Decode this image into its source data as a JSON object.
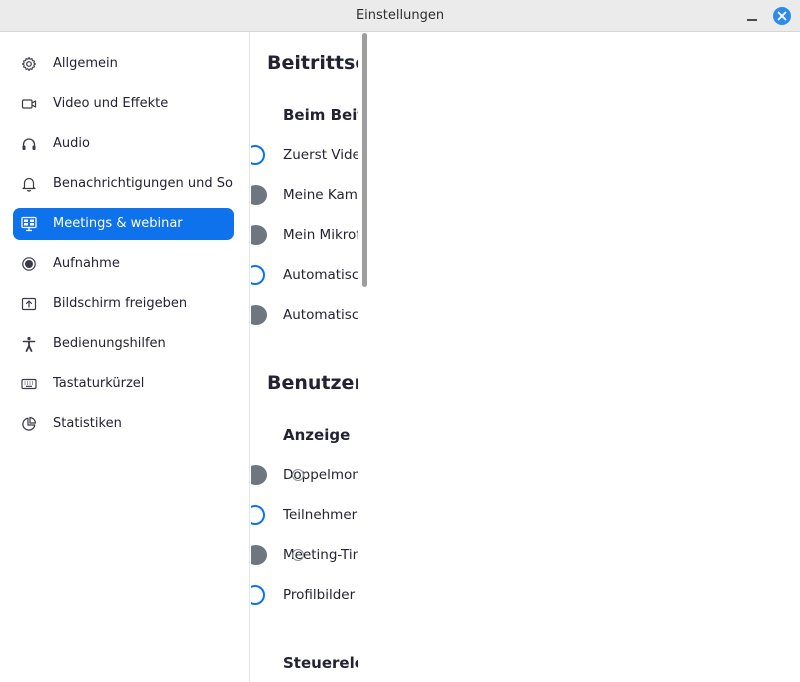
{
  "window": {
    "title": "Einstellungen",
    "minimize_icon": "minimize-icon",
    "close_icon": "close-icon",
    "accent": "#0e72ed"
  },
  "sidebar": {
    "items": [
      {
        "label": "Allgemein",
        "icon": "gear-icon",
        "active": false
      },
      {
        "label": "Video und Effekte",
        "icon": "video-camera-icon",
        "active": false
      },
      {
        "label": "Audio",
        "icon": "headphones-icon",
        "active": false
      },
      {
        "label": "Benachrichtigungen und So…",
        "icon": "bell-icon",
        "active": false
      },
      {
        "label": "Meetings & webinar",
        "icon": "meeting-screen-icon",
        "active": true
      },
      {
        "label": "Aufnahme",
        "icon": "record-icon",
        "active": false
      },
      {
        "label": "Bildschirm freigeben",
        "icon": "share-screen-icon",
        "active": false
      },
      {
        "label": "Bedienungshilfen",
        "icon": "accessibility-icon",
        "active": false
      },
      {
        "label": "Tastaturkürzel",
        "icon": "keyboard-icon",
        "active": false
      },
      {
        "label": "Statistiken",
        "icon": "pie-chart-icon",
        "active": false
      }
    ]
  },
  "main": {
    "section1": {
      "heading": "Beitrittse",
      "subheading": "Beim Beit",
      "options": [
        {
          "label": "Zuerst Video",
          "checked": false
        },
        {
          "label": "Meine Kame",
          "checked": true
        },
        {
          "label": "Mein Mikrof",
          "checked": true
        },
        {
          "label": "Automatisch",
          "checked": false
        },
        {
          "label": "Automatisch",
          "checked": true
        }
      ]
    },
    "section2": {
      "heading": "Benutzere",
      "subheading": "Anzeige",
      "options": [
        {
          "label": "Doppelmon",
          "checked": true
        },
        {
          "label": "Teilnehmern",
          "checked": false
        },
        {
          "label": "Meeting-Tin",
          "checked": true
        },
        {
          "label": "Profilbilder",
          "checked": false
        }
      ]
    },
    "section3": {
      "subheading": "Steuerelem"
    }
  }
}
